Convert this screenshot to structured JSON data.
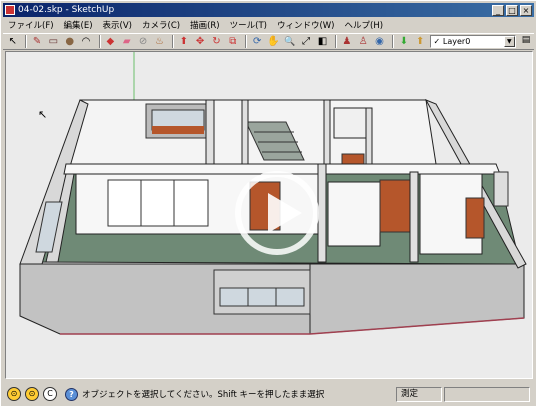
{
  "window": {
    "title": "04-02.skp - SketchUp",
    "controls": [
      "_",
      "□",
      "×"
    ]
  },
  "menu": [
    "ファイル(F)",
    "編集(E)",
    "表示(V)",
    "カメラ(C)",
    "描画(R)",
    "ツール(T)",
    "ウィンドウ(W)",
    "ヘルプ(H)"
  ],
  "toolbar": {
    "tools": [
      {
        "icon": "select-arrow-icon",
        "glyph": "↖"
      },
      {
        "icon": "pencil-icon",
        "glyph": "✎"
      },
      {
        "icon": "rectangle-icon",
        "glyph": "▭"
      },
      {
        "icon": "circle-icon",
        "glyph": "●"
      },
      {
        "icon": "arc-icon",
        "glyph": "◠"
      },
      {
        "icon": "make-component-icon",
        "glyph": "◆"
      },
      {
        "icon": "eraser-icon",
        "glyph": "▰"
      },
      {
        "icon": "tape-measure-icon",
        "glyph": "⊘"
      },
      {
        "icon": "paint-bucket-icon",
        "glyph": "♨"
      },
      {
        "icon": "push-pull-icon",
        "glyph": "⬆"
      },
      {
        "icon": "move-icon",
        "glyph": "✥"
      },
      {
        "icon": "rotate-icon",
        "glyph": "↻"
      },
      {
        "icon": "offset-icon",
        "glyph": "⧉"
      },
      {
        "icon": "orbit-icon",
        "glyph": "⟳"
      },
      {
        "icon": "pan-icon",
        "glyph": "✋"
      },
      {
        "icon": "zoom-icon",
        "glyph": "🔍"
      },
      {
        "icon": "zoom-extents-icon",
        "glyph": "⤢"
      },
      {
        "icon": "previous-view-icon",
        "glyph": "◧"
      },
      {
        "icon": "position-camera-icon",
        "glyph": "♟"
      },
      {
        "icon": "walk-icon",
        "glyph": "♙"
      },
      {
        "icon": "look-around-icon",
        "glyph": "◉"
      },
      {
        "icon": "get-models-icon",
        "glyph": "⬇"
      },
      {
        "icon": "share-model-icon",
        "glyph": "⬆"
      }
    ],
    "layer": {
      "check": "✓",
      "name": "Layer0",
      "dropdown": "▼"
    }
  },
  "status": {
    "message": "オブジェクトを選択してください。Shift キーを押したまま選択",
    "measurements_label": "測定",
    "measurements_value": "",
    "help_glyph": "?",
    "left_icons": [
      "credits-icon",
      "user-icon",
      "geo-location-icon"
    ]
  },
  "colors": {
    "wall": "#f4f4f4",
    "wall_side": "#d8d8d8",
    "floor": "#6f8a76",
    "exterior": "#c2c2c2",
    "door": "#b5562b",
    "base": "#a04050"
  }
}
